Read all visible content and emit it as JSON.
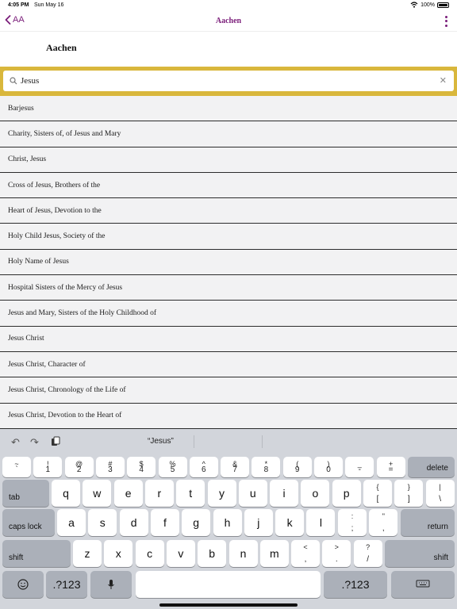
{
  "status": {
    "time": "4:05 PM",
    "date": "Sun May 16",
    "battery": "100%",
    "battery_level": 1.0
  },
  "nav": {
    "back_label": "AA",
    "title": "Aachen"
  },
  "page": {
    "heading": "Aachen"
  },
  "search": {
    "value": "Jesus"
  },
  "results": [
    "Barjesus",
    "Charity, Sisters of, of Jesus and Mary",
    "Christ, Jesus",
    "Cross of Jesus, Brothers of the",
    "Heart of Jesus, Devotion to the",
    "Holy Child Jesus, Society of the",
    "Holy Name of Jesus",
    "Hospital Sisters of the Mercy of Jesus",
    "Jesus and Mary, Sisters of the Holy Childhood of",
    "Jesus Christ",
    "Jesus Christ, Character of",
    "Jesus Christ, Chronology of the Life of",
    "Jesus Christ, Devotion to the Heart of"
  ],
  "keyboard": {
    "suggestion": "“Jesus”",
    "number_row": [
      {
        "top": "~",
        "bot": "`"
      },
      {
        "top": "!",
        "bot": "1"
      },
      {
        "top": "@",
        "bot": "2"
      },
      {
        "top": "#",
        "bot": "3"
      },
      {
        "top": "$",
        "bot": "4"
      },
      {
        "top": "%",
        "bot": "5"
      },
      {
        "top": "^",
        "bot": "6"
      },
      {
        "top": "&",
        "bot": "7"
      },
      {
        "top": "*",
        "bot": "8"
      },
      {
        "top": "(",
        "bot": "9"
      },
      {
        "top": ")",
        "bot": "0"
      },
      {
        "top": "_",
        "bot": "-"
      },
      {
        "top": "+",
        "bot": "="
      }
    ],
    "delete": "delete",
    "tab": "tab",
    "row_q": [
      "q",
      "w",
      "e",
      "r",
      "t",
      "y",
      "u",
      "i",
      "o",
      "p"
    ],
    "row_q_extra": [
      {
        "top": "{",
        "bot": "["
      },
      {
        "top": "}",
        "bot": "]"
      },
      {
        "top": "|",
        "bot": "\\"
      }
    ],
    "caps": "caps lock",
    "row_a": [
      "a",
      "s",
      "d",
      "f",
      "g",
      "h",
      "j",
      "k",
      "l"
    ],
    "row_a_extra": [
      {
        "top": ":",
        "bot": ";"
      },
      {
        "top": "\"",
        "bot": ","
      }
    ],
    "return": "return",
    "shift": "shift",
    "row_z": [
      "z",
      "x",
      "c",
      "v",
      "b",
      "n",
      "m"
    ],
    "row_z_extra": [
      {
        "top": "<",
        "bot": ","
      },
      {
        "top": ">",
        "bot": "."
      },
      {
        "top": "?",
        "bot": "/"
      }
    ],
    "numbers": ".?123"
  },
  "colors": {
    "accent": "#7b1e7a",
    "search_band": "#d9b73c",
    "list_bg": "#f2f2f3",
    "keyboard_bg": "#d2d5db"
  }
}
